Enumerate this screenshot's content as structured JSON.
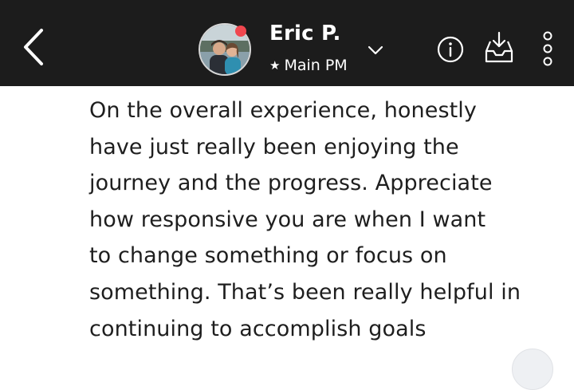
{
  "header": {
    "contact_name": "Eric P.",
    "role_label": "Main PM",
    "role_star": "★",
    "presence_color": "#f0474f",
    "background_color": "#1c1c1c",
    "icons": {
      "back": "chevron-left-icon",
      "dropdown": "chevron-down-icon",
      "info": "info-icon",
      "inbox": "inbox-download-icon",
      "more": "more-vertical-icon"
    }
  },
  "message": {
    "lines": [
      "On the overall experience, honestly",
      "have just really been enjoying the",
      "journey and the progress. Appreciate",
      "how responsive you are when I want",
      "to change something or focus on",
      "something. That’s been really helpful in",
      "continuing to accomplish goals"
    ]
  }
}
